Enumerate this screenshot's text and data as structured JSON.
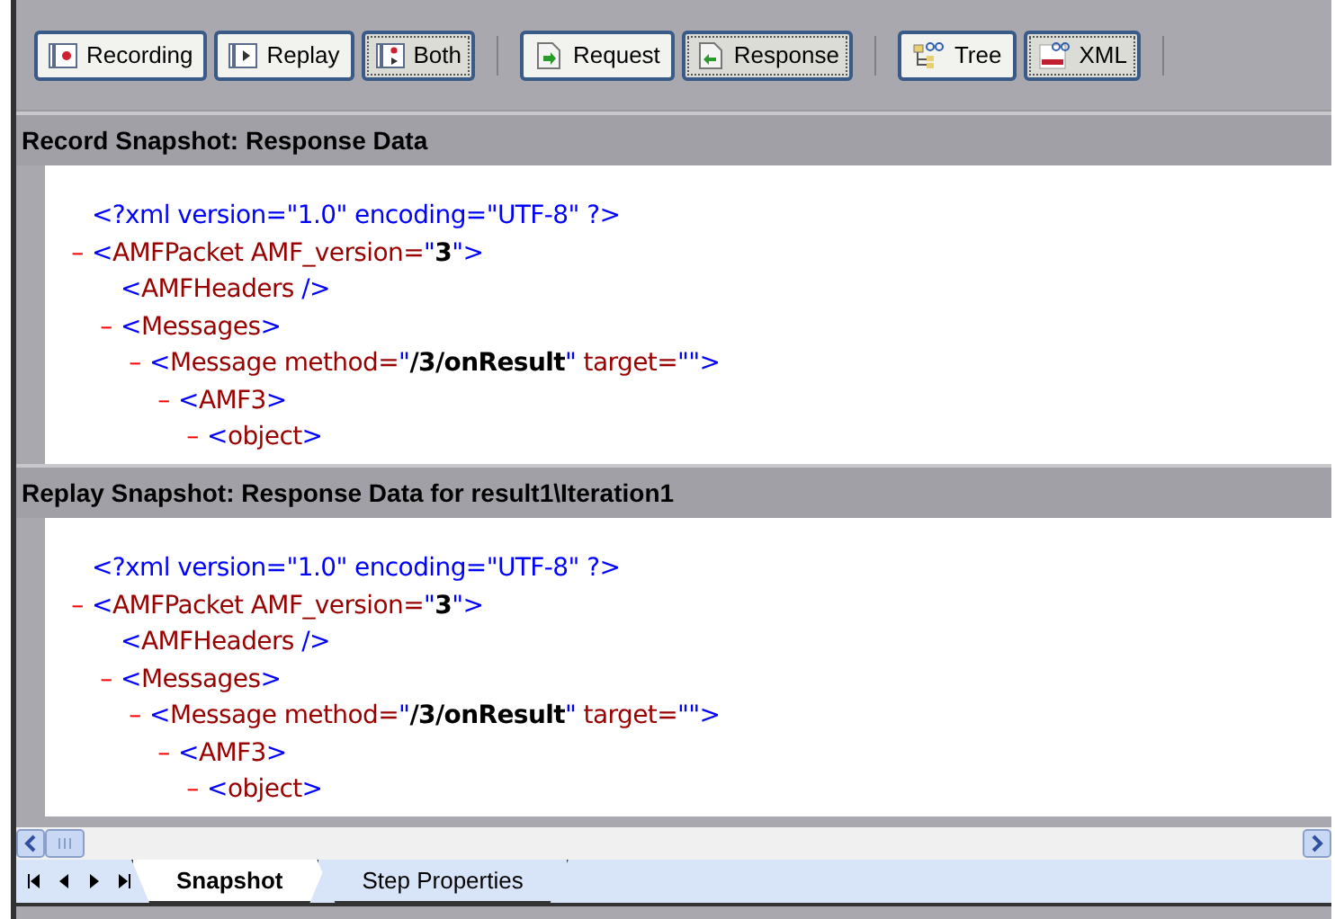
{
  "toolbar": {
    "groups": [
      [
        {
          "label": "Recording",
          "kind": "record",
          "selected": false
        },
        {
          "label": "Replay",
          "kind": "replay",
          "selected": false
        },
        {
          "label": "Both",
          "kind": "both",
          "selected": true
        }
      ],
      [
        {
          "label": "Request",
          "kind": "request",
          "selected": false
        },
        {
          "label": "Response",
          "kind": "response",
          "selected": true
        }
      ],
      [
        {
          "label": "Tree",
          "kind": "tree",
          "selected": false
        },
        {
          "label": "XML",
          "kind": "xml",
          "selected": true
        }
      ]
    ]
  },
  "panes": [
    {
      "title": "Record Snapshot: Response Data",
      "xml": [
        {
          "segments": [
            {
              "text": "<?xml version=\"1.0\" encoding=\"UTF-8\" ?>",
              "kind": "punct"
            }
          ]
        },
        {
          "toggle": "–",
          "segments": [
            {
              "text": "<",
              "kind": "punct"
            },
            {
              "text": "AMFPacket AMF_version=",
              "kind": "name"
            },
            {
              "text": "\"",
              "kind": "punct"
            },
            {
              "text": "3",
              "kind": "value"
            },
            {
              "text": "\">",
              "kind": "punct"
            }
          ],
          "children": [
            {
              "segments": [
                {
                  "text": "<",
                  "kind": "punct"
                },
                {
                  "text": "AMFHeaders",
                  "kind": "name"
                },
                {
                  "text": " />",
                  "kind": "punct"
                }
              ]
            },
            {
              "toggle": "–",
              "segments": [
                {
                  "text": "<",
                  "kind": "punct"
                },
                {
                  "text": "Messages",
                  "kind": "name"
                },
                {
                  "text": ">",
                  "kind": "punct"
                }
              ],
              "children": [
                {
                  "toggle": "–",
                  "segments": [
                    {
                      "text": "<",
                      "kind": "punct"
                    },
                    {
                      "text": "Message method=",
                      "kind": "name"
                    },
                    {
                      "text": "\"",
                      "kind": "punct"
                    },
                    {
                      "text": "/3/onResult",
                      "kind": "value"
                    },
                    {
                      "text": "\"",
                      "kind": "punct"
                    },
                    {
                      "text": " target=",
                      "kind": "name"
                    },
                    {
                      "text": "\"\">",
                      "kind": "punct"
                    }
                  ],
                  "children": [
                    {
                      "toggle": "–",
                      "segments": [
                        {
                          "text": "<",
                          "kind": "punct"
                        },
                        {
                          "text": "AMF3",
                          "kind": "name"
                        },
                        {
                          "text": ">",
                          "kind": "punct"
                        }
                      ],
                      "children": [
                        {
                          "toggle": "–",
                          "segments": [
                            {
                              "text": "<",
                              "kind": "punct"
                            },
                            {
                              "text": "object",
                              "kind": "name"
                            },
                            {
                              "text": ">",
                              "kind": "punct"
                            }
                          ]
                        }
                      ]
                    }
                  ]
                }
              ]
            }
          ]
        }
      ]
    },
    {
      "title": "Replay Snapshot: Response Data for result1\\Iteration1",
      "xml": [
        {
          "segments": [
            {
              "text": "<?xml version=\"1.0\" encoding=\"UTF-8\" ?>",
              "kind": "punct"
            }
          ]
        },
        {
          "toggle": "–",
          "segments": [
            {
              "text": "<",
              "kind": "punct"
            },
            {
              "text": "AMFPacket AMF_version=",
              "kind": "name"
            },
            {
              "text": "\"",
              "kind": "punct"
            },
            {
              "text": "3",
              "kind": "value"
            },
            {
              "text": "\">",
              "kind": "punct"
            }
          ],
          "children": [
            {
              "segments": [
                {
                  "text": "<",
                  "kind": "punct"
                },
                {
                  "text": "AMFHeaders",
                  "kind": "name"
                },
                {
                  "text": " />",
                  "kind": "punct"
                }
              ]
            },
            {
              "toggle": "–",
              "segments": [
                {
                  "text": "<",
                  "kind": "punct"
                },
                {
                  "text": "Messages",
                  "kind": "name"
                },
                {
                  "text": ">",
                  "kind": "punct"
                }
              ],
              "children": [
                {
                  "toggle": "–",
                  "segments": [
                    {
                      "text": "<",
                      "kind": "punct"
                    },
                    {
                      "text": "Message method=",
                      "kind": "name"
                    },
                    {
                      "text": "\"",
                      "kind": "punct"
                    },
                    {
                      "text": "/3/onResult",
                      "kind": "value"
                    },
                    {
                      "text": "\"",
                      "kind": "punct"
                    },
                    {
                      "text": " target=",
                      "kind": "name"
                    },
                    {
                      "text": "\"\">",
                      "kind": "punct"
                    }
                  ],
                  "children": [
                    {
                      "toggle": "–",
                      "segments": [
                        {
                          "text": "<",
                          "kind": "punct"
                        },
                        {
                          "text": "AMF3",
                          "kind": "name"
                        },
                        {
                          "text": ">",
                          "kind": "punct"
                        }
                      ],
                      "children": [
                        {
                          "toggle": "–",
                          "segments": [
                            {
                              "text": "<",
                              "kind": "punct"
                            },
                            {
                              "text": "object",
                              "kind": "name"
                            },
                            {
                              "text": ">",
                              "kind": "punct"
                            }
                          ]
                        }
                      ]
                    }
                  ]
                }
              ]
            }
          ]
        }
      ]
    }
  ],
  "tabs": [
    {
      "label": "Snapshot",
      "selected": true
    },
    {
      "label": "Step Properties",
      "selected": false
    }
  ]
}
